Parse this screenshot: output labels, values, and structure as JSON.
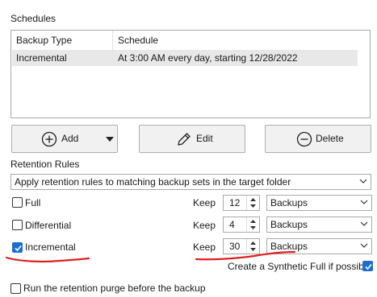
{
  "schedules": {
    "title": "Schedules",
    "columns": [
      "Backup Type",
      "Schedule"
    ],
    "rows": [
      {
        "type": "Incremental",
        "schedule": "At 3:00 AM every day, starting 12/28/2022"
      }
    ]
  },
  "buttons": {
    "add": "Add",
    "edit": "Edit",
    "delete": "Delete"
  },
  "retention": {
    "title": "Retention Rules",
    "rule_mode": "Apply retention rules to matching backup sets in the target folder",
    "keep_label": "Keep",
    "rows": [
      {
        "label": "Full",
        "checked": false,
        "keep": "12",
        "unit": "Backups"
      },
      {
        "label": "Differential",
        "checked": false,
        "keep": "4",
        "unit": "Backups"
      },
      {
        "label": "Incremental",
        "checked": true,
        "keep": "30",
        "unit": "Backups"
      }
    ],
    "synthetic_full": {
      "label": "Create a Synthetic Full if possible",
      "checked": true
    },
    "purge_before": {
      "label": "Run the retention purge before the backup",
      "checked": false
    }
  },
  "colors": {
    "accent": "#1c6fd1",
    "annotation": "#e01f1f",
    "selected_row": "#e8e8e8"
  },
  "icons": {
    "add": "plus-circle-icon",
    "edit": "pencil-icon",
    "delete": "minus-circle-icon",
    "dropdown": "chevron-down-icon"
  }
}
